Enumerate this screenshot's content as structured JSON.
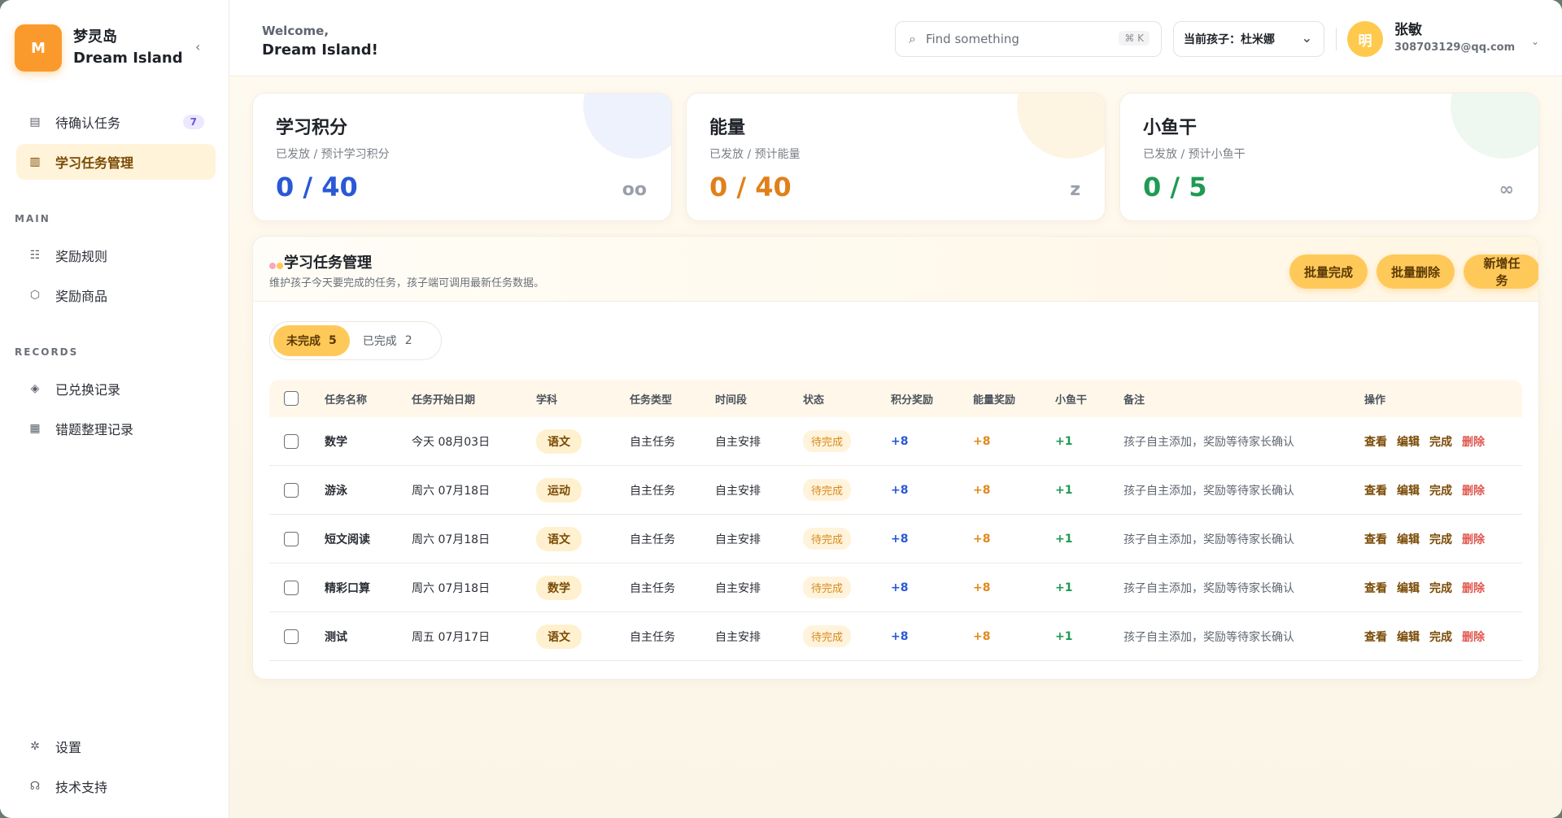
{
  "brand": {
    "logo_letter": "M",
    "name_cn": "梦灵岛",
    "name_en": "Dream Island"
  },
  "sidebar": {
    "top_items": [
      {
        "label": "待确认任务",
        "icon": "clipboard-icon",
        "badge": "7"
      },
      {
        "label": "学习任务管理",
        "icon": "document-icon",
        "active": true
      }
    ],
    "section_main": "MAIN",
    "main_items": [
      {
        "label": "奖励规则",
        "icon": "rules-icon"
      },
      {
        "label": "奖励商品",
        "icon": "box-icon"
      }
    ],
    "section_records": "RECORDS",
    "records_items": [
      {
        "label": "已兑换记录",
        "icon": "layers-icon"
      },
      {
        "label": "错题整理记录",
        "icon": "notebook-icon"
      }
    ],
    "bottom_items": [
      {
        "label": "设置",
        "icon": "gear-icon"
      },
      {
        "label": "技术支持",
        "icon": "headset-icon"
      }
    ]
  },
  "topbar": {
    "welcome_line1": "Welcome,",
    "welcome_line2": "Dream Island!",
    "search_placeholder": "Find something",
    "search_shortcut": "⌘ K",
    "child_select": "当前孩子：杜米娜",
    "avatar_letter": "明",
    "user_name": "张敏",
    "user_email": "308703129@qq.com"
  },
  "stats": [
    {
      "title": "学习积分",
      "subtitle": "已发放 / 预计学习积分",
      "value": "0 / 40",
      "mark": "oo",
      "color": "#2a59d6",
      "deco": "#eef2fd"
    },
    {
      "title": "能量",
      "subtitle": "已发放 / 预计能量",
      "value": "0 / 40",
      "mark": "z",
      "color": "#e0801a",
      "deco": "#fdf5e2"
    },
    {
      "title": "小鱼干",
      "subtitle": "已发放 / 预计小鱼干",
      "value": "0 / 5",
      "mark": "∞",
      "color": "#1f9a55",
      "deco": "#eef8f1"
    }
  ],
  "panel": {
    "title": "学习任务管理",
    "description": "维护孩子今天要完成的任务，孩子端可调用最新任务数据。",
    "buttons": [
      "批量完成",
      "批量删除",
      "新增任务"
    ],
    "tabs": [
      {
        "label": "未完成",
        "count": "5",
        "active": true
      },
      {
        "label": "已完成",
        "count": "2"
      }
    ],
    "columns": [
      "任务名称",
      "任务开始日期",
      "学科",
      "任务类型",
      "时间段",
      "状态",
      "积分奖励",
      "能量奖励",
      "小鱼干",
      "备注",
      "操作"
    ],
    "rows": [
      {
        "name": "数学",
        "date": "今天 08月03日",
        "subject": "语文",
        "type": "自主任务",
        "period": "自主安排",
        "status": "待完成",
        "points": "+8",
        "energy": "+8",
        "fish": "+1",
        "note": "孩子自主添加，奖励等待家长确认"
      },
      {
        "name": "游泳",
        "date": "周六 07月18日",
        "subject": "运动",
        "type": "自主任务",
        "period": "自主安排",
        "status": "待完成",
        "points": "+8",
        "energy": "+8",
        "fish": "+1",
        "note": "孩子自主添加，奖励等待家长确认"
      },
      {
        "name": "短文阅读",
        "date": "周六 07月18日",
        "subject": "语文",
        "type": "自主任务",
        "period": "自主安排",
        "status": "待完成",
        "points": "+8",
        "energy": "+8",
        "fish": "+1",
        "note": "孩子自主添加，奖励等待家长确认"
      },
      {
        "name": "精彩口算",
        "date": "周六 07月18日",
        "subject": "数学",
        "type": "自主任务",
        "period": "自主安排",
        "status": "待完成",
        "points": "+8",
        "energy": "+8",
        "fish": "+1",
        "note": "孩子自主添加，奖励等待家长确认"
      },
      {
        "name": "测试",
        "date": "周五 07月17日",
        "subject": "语文",
        "type": "自主任务",
        "period": "自主安排",
        "status": "待完成",
        "points": "+8",
        "energy": "+8",
        "fish": "+1",
        "note": "孩子自主添加，奖励等待家长确认"
      }
    ],
    "actions": [
      "查看",
      "编辑",
      "完成",
      "删除"
    ]
  }
}
